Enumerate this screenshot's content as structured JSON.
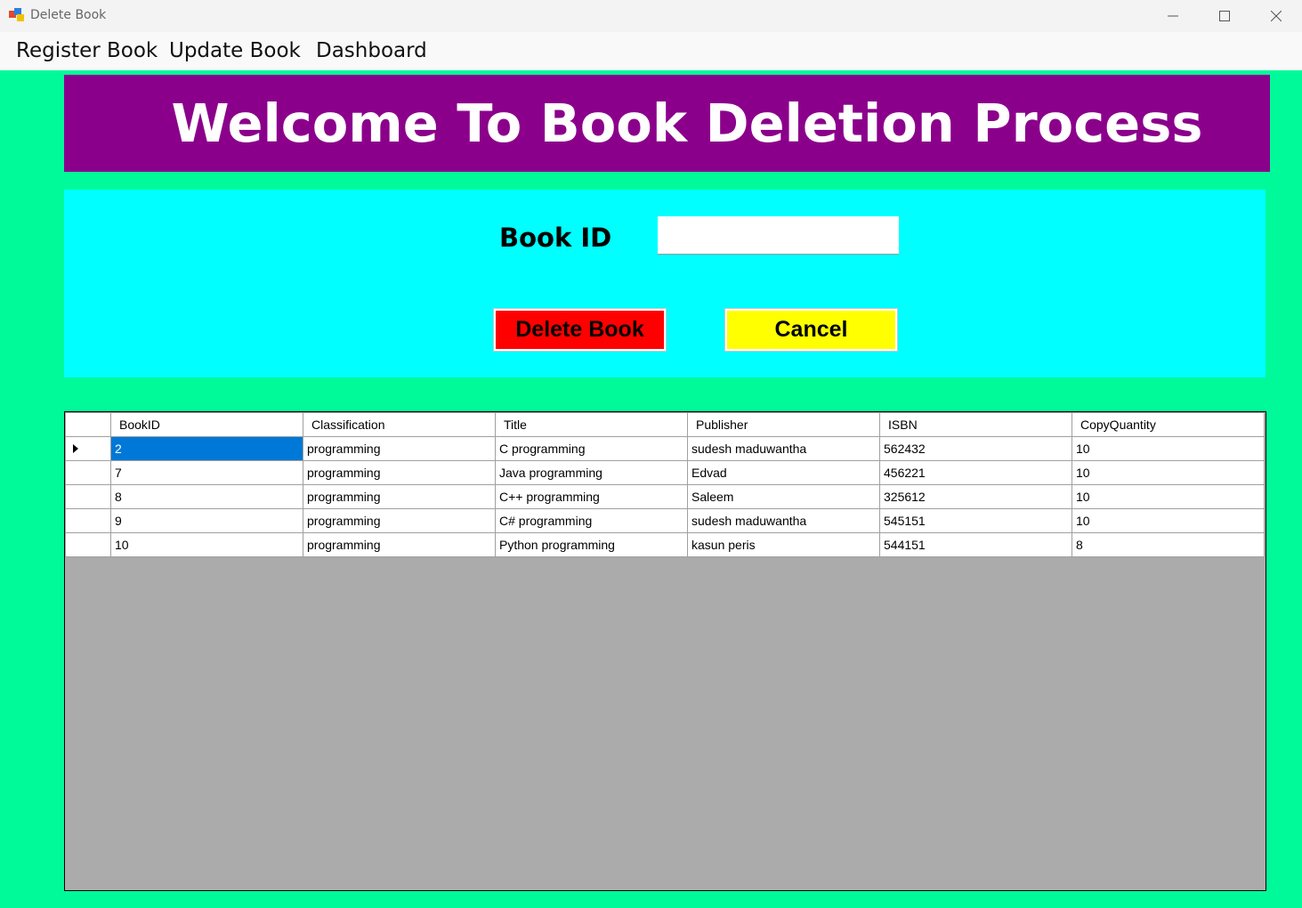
{
  "window": {
    "title": "Delete Book",
    "controls": {
      "minimize_icon": "minimize-icon",
      "maximize_icon": "maximize-icon",
      "close_icon": "close-icon"
    }
  },
  "menu": {
    "items": [
      {
        "label": "Register Book"
      },
      {
        "label": "Update Book"
      },
      {
        "label": "Dashboard"
      }
    ]
  },
  "banner": {
    "title": "Welcome To Book Deletion Process"
  },
  "form": {
    "book_id_label": "Book ID",
    "book_id_value": "",
    "delete_label": "Delete Book",
    "cancel_label": "Cancel"
  },
  "colors": {
    "form_background": "#00fa9a",
    "banner": "#8b008b",
    "panel": "#00ffff",
    "delete_button": "#ff0000",
    "cancel_button": "#ffff00",
    "selected_cell": "#0078d7",
    "grid_background": "#ababab"
  },
  "grid": {
    "columns": [
      "BookID",
      "Classification",
      "Title",
      "Publisher",
      "ISBN",
      "CopyQuantity"
    ],
    "rows": [
      [
        "2",
        "programming",
        "C programming",
        "sudesh maduwantha",
        "562432",
        "10"
      ],
      [
        "7",
        "programming",
        "Java programming",
        "Edvad",
        "456221",
        "10"
      ],
      [
        "8",
        "programming",
        "C++ programming",
        "Saleem",
        "325612",
        "10"
      ],
      [
        "9",
        "programming",
        "C# programming",
        "sudesh maduwantha",
        "545151",
        "10"
      ],
      [
        "10",
        "programming",
        "Python programming",
        "kasun peris",
        "544151",
        "8"
      ]
    ],
    "current_row_icon": "row-pointer-icon"
  }
}
